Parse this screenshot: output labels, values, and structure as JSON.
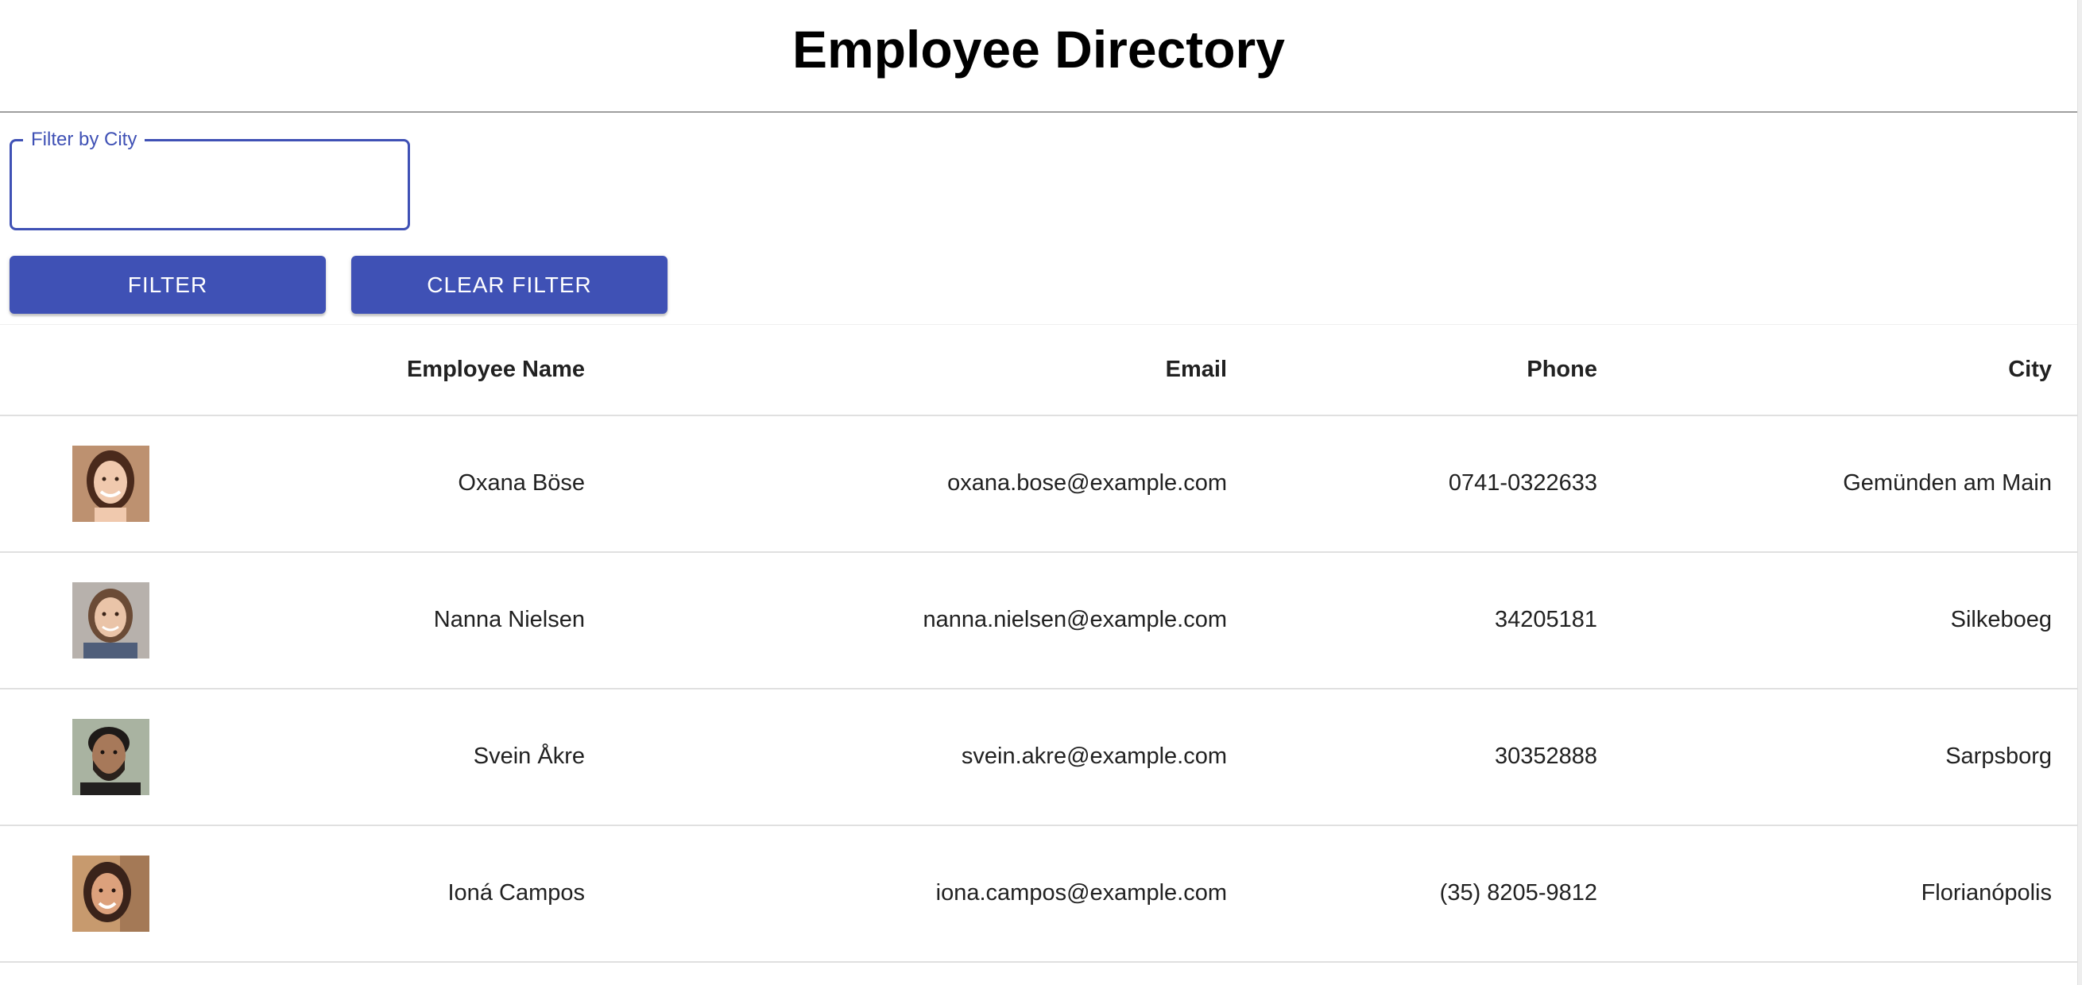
{
  "header": {
    "title": "Employee Directory"
  },
  "filter": {
    "label": "Filter by City",
    "value": "",
    "filter_button": "FILTER",
    "clear_button": "CLEAR FILTER"
  },
  "colors": {
    "accent": "#3f51b5",
    "border": "#e0e0e0"
  },
  "table": {
    "columns": [
      "",
      "Employee Name",
      "Email",
      "Phone",
      "City"
    ],
    "rows": [
      {
        "name": "Oxana Böse",
        "email": "oxana.bose@example.com",
        "phone": "0741-0322633",
        "city": "Gemünden am Main",
        "photo": "portrait-woman-dark-hair-smiling"
      },
      {
        "name": "Nanna Nielsen",
        "email": "nanna.nielsen@example.com",
        "phone": "34205181",
        "city": "Silkeboeg",
        "photo": "portrait-woman-brown-hair"
      },
      {
        "name": "Svein Åkre",
        "email": "svein.akre@example.com",
        "phone": "30352888",
        "city": "Sarpsborg",
        "photo": "portrait-man-beard"
      },
      {
        "name": "Ioná Campos",
        "email": "iona.campos@example.com",
        "phone": "(35) 8205-9812",
        "city": "Florianópolis",
        "photo": "portrait-woman-smiling"
      }
    ]
  }
}
